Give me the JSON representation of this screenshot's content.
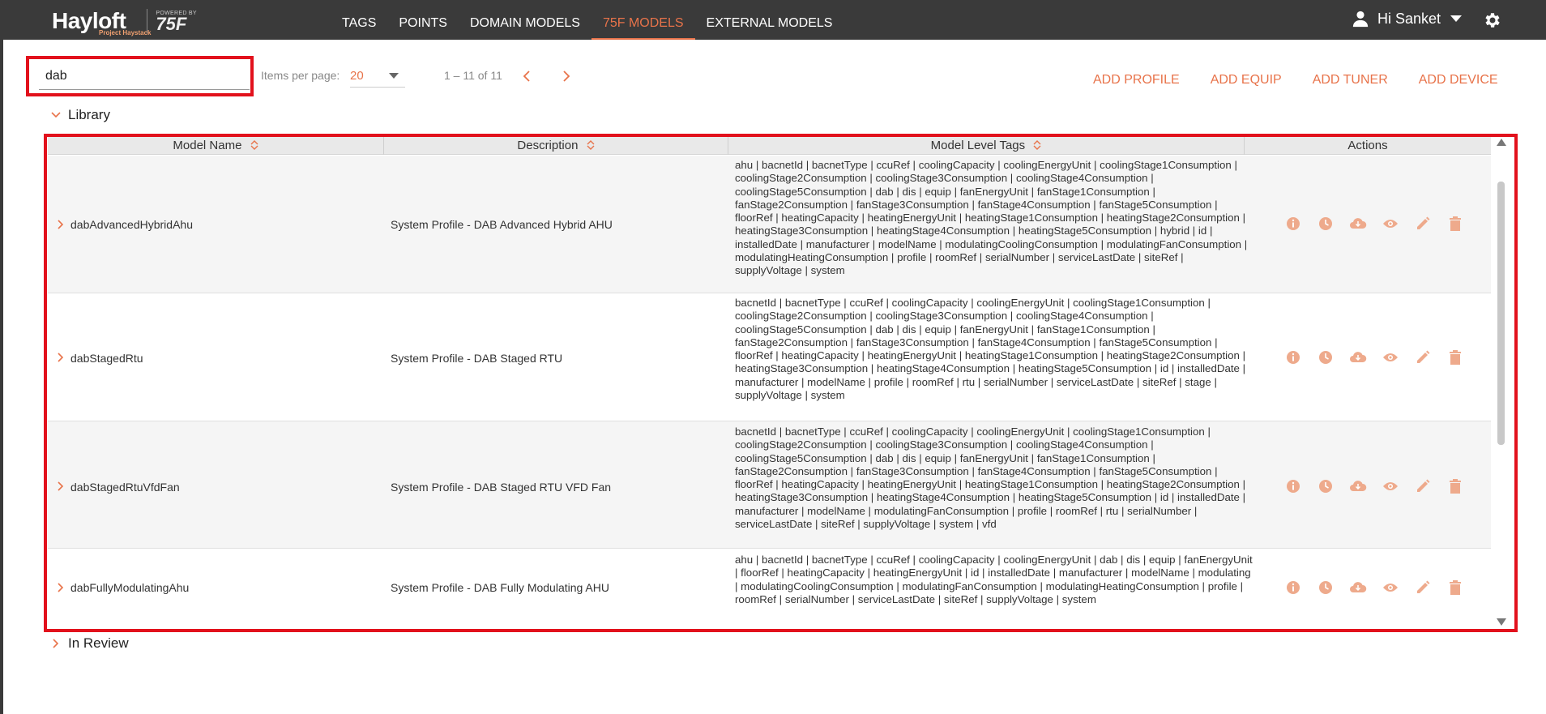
{
  "brand": {
    "name": "Hayloft",
    "sub": "Project Haystack",
    "powered_by": "POWERED BY",
    "partner": "75F"
  },
  "nav": {
    "items": [
      {
        "label": "TAGS"
      },
      {
        "label": "POINTS"
      },
      {
        "label": "DOMAIN MODELS"
      },
      {
        "label": "75F MODELS"
      },
      {
        "label": "EXTERNAL MODELS"
      }
    ],
    "active": "75F MODELS"
  },
  "user": {
    "greeting": "Hi Sanket"
  },
  "search": {
    "value": "dab"
  },
  "pager": {
    "items_per_page_label": "Items per page:",
    "items_per_page": "20",
    "range": "1 – 11 of 11"
  },
  "top_actions": [
    {
      "label": "ADD PROFILE"
    },
    {
      "label": "ADD EQUIP"
    },
    {
      "label": "ADD TUNER"
    },
    {
      "label": "ADD DEVICE"
    }
  ],
  "sections": {
    "library": "Library",
    "in_review": "In Review"
  },
  "table": {
    "columns": [
      {
        "label": "Model Name"
      },
      {
        "label": "Description"
      },
      {
        "label": "Model Level Tags"
      },
      {
        "label": "Actions"
      }
    ],
    "action_icons": [
      "info-icon",
      "history-icon",
      "download-icon",
      "view-icon",
      "edit-icon",
      "delete-icon"
    ],
    "rows": [
      {
        "name": "dabAdvancedHybridAhu",
        "description": "System Profile - DAB Advanced Hybrid AHU",
        "tags": "ahu | bacnetId | bacnetType | ccuRef | coolingCapacity | coolingEnergyUnit | coolingStage1Consumption | coolingStage2Consumption | coolingStage3Consumption | coolingStage4Consumption | coolingStage5Consumption | dab | dis | equip | fanEnergyUnit | fanStage1Consumption | fanStage2Consumption | fanStage3Consumption | fanStage4Consumption | fanStage5Consumption | floorRef | heatingCapacity | heatingEnergyUnit | heatingStage1Consumption | heatingStage2Consumption | heatingStage3Consumption | heatingStage4Consumption | heatingStage5Consumption | hybrid | id | installedDate | manufacturer | modelName | modulatingCoolingConsumption | modulatingFanConsumption | modulatingHeatingConsumption | profile | roomRef | serialNumber | serviceLastDate | siteRef | supplyVoltage | system"
      },
      {
        "name": "dabStagedRtu",
        "description": "System Profile - DAB Staged RTU",
        "tags": "bacnetId | bacnetType | ccuRef | coolingCapacity | coolingEnergyUnit | coolingStage1Consumption | coolingStage2Consumption | coolingStage3Consumption | coolingStage4Consumption | coolingStage5Consumption | dab | dis | equip | fanEnergyUnit | fanStage1Consumption | fanStage2Consumption | fanStage3Consumption | fanStage4Consumption | fanStage5Consumption | floorRef | heatingCapacity | heatingEnergyUnit | heatingStage1Consumption | heatingStage2Consumption | heatingStage3Consumption | heatingStage4Consumption | heatingStage5Consumption | id | installedDate | manufacturer | modelName | profile | roomRef | rtu | serialNumber | serviceLastDate | siteRef | stage | supplyVoltage | system"
      },
      {
        "name": "dabStagedRtuVfdFan",
        "description": "System Profile - DAB Staged RTU VFD Fan",
        "tags": "bacnetId | bacnetType | ccuRef | coolingCapacity | coolingEnergyUnit | coolingStage1Consumption | coolingStage2Consumption | coolingStage3Consumption | coolingStage4Consumption | coolingStage5Consumption | dab | dis | equip | fanEnergyUnit | fanStage1Consumption | fanStage2Consumption | fanStage3Consumption | fanStage4Consumption | fanStage5Consumption | floorRef | heatingCapacity | heatingEnergyUnit | heatingStage1Consumption | heatingStage2Consumption | heatingStage3Consumption | heatingStage4Consumption | heatingStage5Consumption | id | installedDate | manufacturer | modelName | modulatingFanConsumption | profile | roomRef | rtu | serialNumber | serviceLastDate | siteRef | supplyVoltage | system | vfd"
      },
      {
        "name": "dabFullyModulatingAhu",
        "description": "System Profile - DAB Fully Modulating AHU",
        "tags": "ahu | bacnetId | bacnetType | ccuRef | coolingCapacity | coolingEnergyUnit | dab | dis | equip | fanEnergyUnit | floorRef | heatingCapacity | heatingEnergyUnit | id | installedDate | manufacturer | modelName | modulating | modulatingCoolingConsumption | modulatingFanConsumption | modulatingHeatingConsumption | profile | roomRef | serialNumber | serviceLastDate | siteRef | supplyVoltage | system"
      }
    ]
  },
  "colors": {
    "accent": "#e8734a",
    "action_icon": "#eeaa8c",
    "topbar": "#3a3a3a",
    "highlight": "#e2111c"
  }
}
